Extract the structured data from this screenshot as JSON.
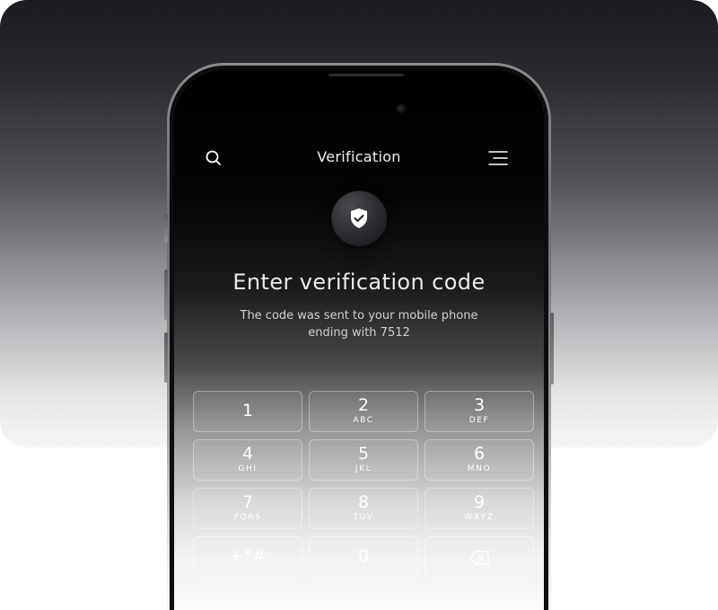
{
  "header": {
    "title": "Verification",
    "search_icon": "search-icon",
    "menu_icon": "menu-icon"
  },
  "badge": {
    "icon": "shield-check-icon"
  },
  "main": {
    "heading": "Enter verification code",
    "subtext_line1": "The code was sent to your mobile phone",
    "subtext_line2": "ending with 7512"
  },
  "keypad": {
    "keys": [
      {
        "digit": "1",
        "letters": ""
      },
      {
        "digit": "2",
        "letters": "ABC"
      },
      {
        "digit": "3",
        "letters": "DEF"
      },
      {
        "digit": "4",
        "letters": "GHI"
      },
      {
        "digit": "5",
        "letters": "JKL"
      },
      {
        "digit": "6",
        "letters": "MNO"
      },
      {
        "digit": "7",
        "letters": "PQRS"
      },
      {
        "digit": "8",
        "letters": "TUV"
      },
      {
        "digit": "9",
        "letters": "WXYZ"
      },
      {
        "digit": "+*#",
        "letters": ""
      },
      {
        "digit": "0",
        "letters": ""
      }
    ],
    "delete_icon": "backspace-icon"
  },
  "colors": {
    "screen_top": "#000000",
    "text": "#f2f2f2",
    "key_border": "#ffffff"
  }
}
